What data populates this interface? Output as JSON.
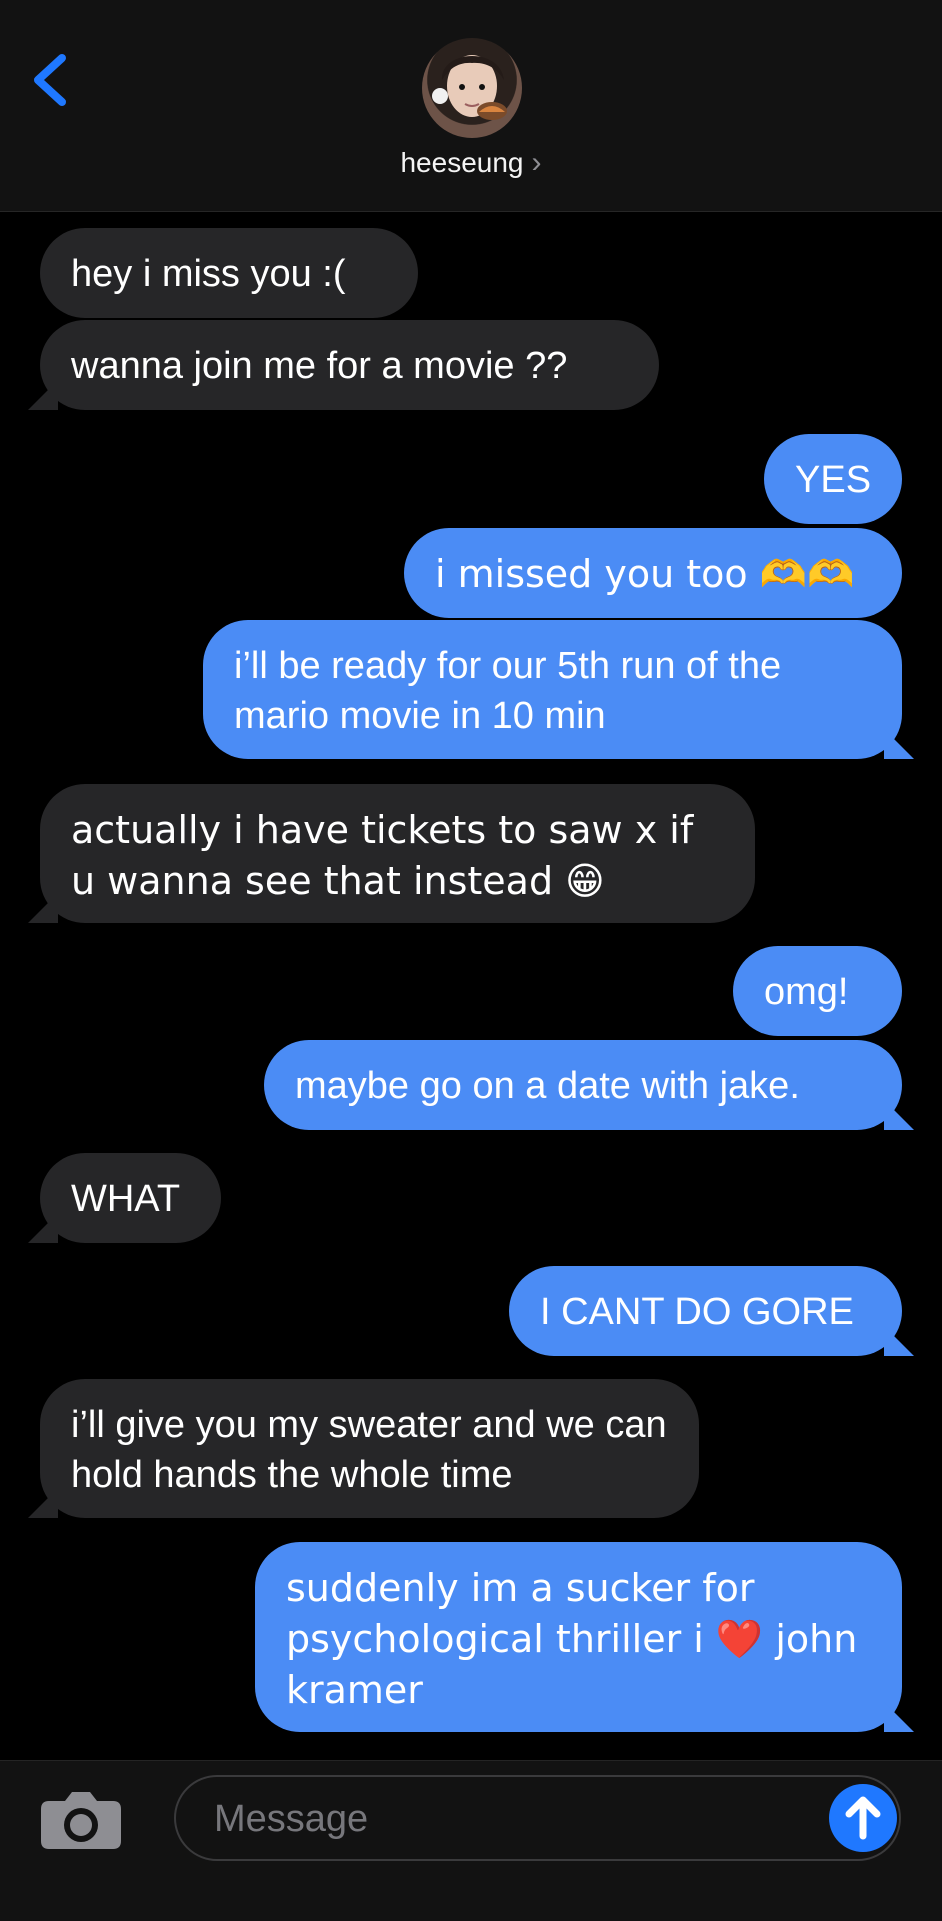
{
  "header": {
    "contact_name": "heeseung",
    "chevron": "›",
    "back_icon": "chevron-left-icon",
    "avatar": "contact-avatar"
  },
  "messages": [
    {
      "direction": "incoming",
      "text": "hey i miss you :("
    },
    {
      "direction": "incoming",
      "text": "wanna join me for a movie ??"
    },
    {
      "direction": "outgoing",
      "text": "YES"
    },
    {
      "direction": "outgoing",
      "text": "i missed you too 🫶🫶"
    },
    {
      "direction": "outgoing",
      "text": "i’ll be ready for our 5th run of the mario movie in 10 min"
    },
    {
      "direction": "incoming",
      "text": "actually i have tickets to saw x if u wanna see that instead 😁"
    },
    {
      "direction": "outgoing",
      "text": "omg!"
    },
    {
      "direction": "outgoing",
      "text": "maybe go on a date with jake."
    },
    {
      "direction": "incoming",
      "text": "WHAT"
    },
    {
      "direction": "outgoing",
      "text": "I CANT DO GORE"
    },
    {
      "direction": "incoming",
      "text": "i’ll give you my sweater and we can hold hands the whole time"
    },
    {
      "direction": "outgoing",
      "text": "suddenly im a sucker for psychological thriller i ❤️ john kramer"
    }
  ],
  "composer": {
    "placeholder": "Message",
    "camera_icon": "camera-icon",
    "send_icon": "arrow-up-icon"
  },
  "colors": {
    "background": "#000000",
    "header": "#121212",
    "incoming_bubble": "#262628",
    "outgoing_bubble": "#4b8cf5",
    "accent": "#1f78ff"
  }
}
